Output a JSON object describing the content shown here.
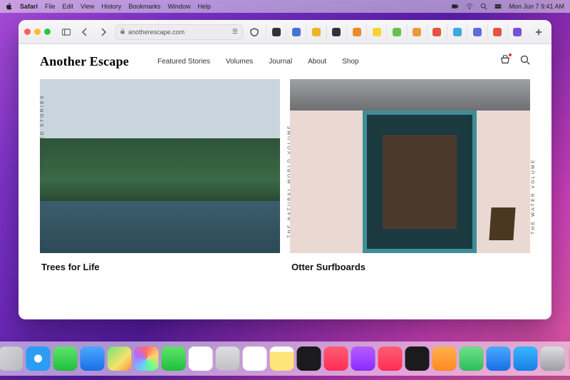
{
  "menubar": {
    "app": "Safari",
    "items": [
      "File",
      "Edit",
      "View",
      "History",
      "Bookmarks",
      "Window",
      "Help"
    ],
    "clock": "Mon Jun 7  9:41 AM"
  },
  "browser": {
    "url": "anotherescape.com",
    "tab_colors": [
      "#333333",
      "#4573d6",
      "#f0b12f",
      "#333333",
      "#e98b2e",
      "#f7d235",
      "#68c24a",
      "#ea9a3a",
      "#e3543f",
      "#3da9e0",
      "#5d6bdc",
      "#e3543f",
      "#7652d6"
    ]
  },
  "site": {
    "brand": "Another Escape",
    "nav": [
      "Featured Stories",
      "Volumes",
      "Journal",
      "About",
      "Shop"
    ],
    "sidebar_label": "FEATURED STORIES",
    "volume_labels": [
      "THE NATURAL WORLD VOLUME",
      "THE WATER VOLUME"
    ],
    "cards": [
      {
        "title": "Trees for Life"
      },
      {
        "title": "Otter Surfboards"
      }
    ]
  },
  "dock": {
    "apps": [
      {
        "name": "finder",
        "bg": "linear-gradient(135deg,#2ea8ff,#0d6fe0)"
      },
      {
        "name": "launchpad",
        "bg": "linear-gradient(135deg,#d6d6da,#b9b9bf)"
      },
      {
        "name": "safari",
        "bg": "radial-gradient(circle at 50% 50%,#fff 22%,#2a9df4 24%)"
      },
      {
        "name": "messages",
        "bg": "linear-gradient(#5fe36a,#1fbf3c)"
      },
      {
        "name": "mail",
        "bg": "linear-gradient(#4aa9ff,#1a6fe6)"
      },
      {
        "name": "maps",
        "bg": "linear-gradient(135deg,#72e27e,#f8e26a 60%,#f58f4b)"
      },
      {
        "name": "photos",
        "bg": "conic-gradient(#ff6b6b,#ffd36b,#6bff8b,#6bc7ff,#b36bff,#ff6b6b)"
      },
      {
        "name": "facetime",
        "bg": "linear-gradient(#5fe36a,#1fbf3c)"
      },
      {
        "name": "calendar",
        "bg": "#fff"
      },
      {
        "name": "contacts",
        "bg": "linear-gradient(#dedee2,#bfbfc4)"
      },
      {
        "name": "reminders",
        "bg": "#fff"
      },
      {
        "name": "notes",
        "bg": "linear-gradient(#fff 22%,#ffe47a 22%)"
      },
      {
        "name": "tv",
        "bg": "#1b1b1d"
      },
      {
        "name": "music",
        "bg": "linear-gradient(#ff5d74,#ff2d55)"
      },
      {
        "name": "podcasts",
        "bg": "linear-gradient(#b95cff,#8a2cff)"
      },
      {
        "name": "news",
        "bg": "linear-gradient(#ff5d74,#ff2d55)"
      },
      {
        "name": "stocks",
        "bg": "#1b1b1d"
      },
      {
        "name": "books",
        "bg": "linear-gradient(#ffb04d,#ff8a1f)"
      },
      {
        "name": "numbers",
        "bg": "linear-gradient(#6de08a,#2ebf5b)"
      },
      {
        "name": "keynote",
        "bg": "linear-gradient(#4aa9ff,#1a6fe6)"
      },
      {
        "name": "appstore",
        "bg": "linear-gradient(#38b7ff,#1a7fe6)"
      },
      {
        "name": "settings",
        "bg": "linear-gradient(#dedee2,#9d9da4)"
      }
    ],
    "trash": {
      "name": "trash",
      "bg": "linear-gradient(#e6e6ea,#c8c8cd)"
    }
  }
}
